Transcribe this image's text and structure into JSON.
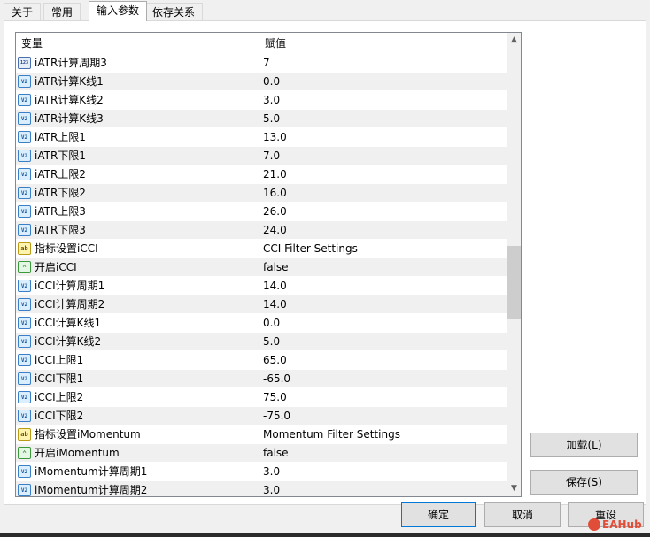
{
  "tabs": [
    {
      "label": "关于",
      "active": false
    },
    {
      "label": "常用",
      "active": false
    },
    {
      "label": "输入参数",
      "active": true
    },
    {
      "label": "依存关系",
      "active": false
    }
  ],
  "grid": {
    "col_variable": "变量",
    "col_value": "赋值",
    "rows": [
      {
        "icon": "integer-icon",
        "glyph": "123",
        "name": "iATR计算周期3",
        "value": "7"
      },
      {
        "icon": "double-icon",
        "glyph": "V2",
        "name": "iATR计算K线1",
        "value": "0.0"
      },
      {
        "icon": "double-icon",
        "glyph": "V2",
        "name": "iATR计算K线2",
        "value": "3.0"
      },
      {
        "icon": "double-icon",
        "glyph": "V2",
        "name": "iATR计算K线3",
        "value": "5.0"
      },
      {
        "icon": "double-icon",
        "glyph": "V2",
        "name": "iATR上限1",
        "value": "13.0"
      },
      {
        "icon": "double-icon",
        "glyph": "V2",
        "name": "iATR下限1",
        "value": "7.0"
      },
      {
        "icon": "double-icon",
        "glyph": "V2",
        "name": "iATR上限2",
        "value": "21.0"
      },
      {
        "icon": "double-icon",
        "glyph": "V2",
        "name": "iATR下限2",
        "value": "16.0"
      },
      {
        "icon": "double-icon",
        "glyph": "V2",
        "name": "iATR上限3",
        "value": "26.0"
      },
      {
        "icon": "double-icon",
        "glyph": "V2",
        "name": "iATR下限3",
        "value": "24.0"
      },
      {
        "icon": "string-icon",
        "glyph": "ab",
        "name": "指标设置iCCI",
        "value": "CCI Filter Settings"
      },
      {
        "icon": "bool-icon",
        "glyph": "⌃",
        "name": "开启iCCI",
        "value": "false"
      },
      {
        "icon": "double-icon",
        "glyph": "V2",
        "name": "iCCI计算周期1",
        "value": "14.0"
      },
      {
        "icon": "double-icon",
        "glyph": "V2",
        "name": "iCCI计算周期2",
        "value": "14.0"
      },
      {
        "icon": "double-icon",
        "glyph": "V2",
        "name": "iCCI计算K线1",
        "value": "0.0"
      },
      {
        "icon": "double-icon",
        "glyph": "V2",
        "name": "iCCI计算K线2",
        "value": "5.0"
      },
      {
        "icon": "double-icon",
        "glyph": "V2",
        "name": "iCCI上限1",
        "value": "65.0"
      },
      {
        "icon": "double-icon",
        "glyph": "V2",
        "name": "iCCI下限1",
        "value": "-65.0"
      },
      {
        "icon": "double-icon",
        "glyph": "V2",
        "name": "iCCI上限2",
        "value": "75.0"
      },
      {
        "icon": "double-icon",
        "glyph": "V2",
        "name": "iCCI下限2",
        "value": "-75.0"
      },
      {
        "icon": "string-icon",
        "glyph": "ab",
        "name": "指标设置iMomentum",
        "value": "Momentum Filter Settings"
      },
      {
        "icon": "bool-icon",
        "glyph": "⌃",
        "name": "开启iMomentum",
        "value": "false"
      },
      {
        "icon": "double-icon",
        "glyph": "V2",
        "name": "iMomentum计算周期1",
        "value": "3.0"
      },
      {
        "icon": "double-icon",
        "glyph": "V2",
        "name": "iMomentum计算周期2",
        "value": "3.0"
      }
    ],
    "scroll_position": 0.55,
    "scroll_visible_fraction": 0.17
  },
  "buttons": {
    "load": "加载(L)",
    "save": "保存(S)",
    "ok": "确定",
    "cancel": "取消",
    "reset": "重设"
  },
  "watermark": "EAHub",
  "colors": {
    "row_alt": "#f0f0f0",
    "accent": "#0078d7",
    "watermark": "#e04e39"
  }
}
